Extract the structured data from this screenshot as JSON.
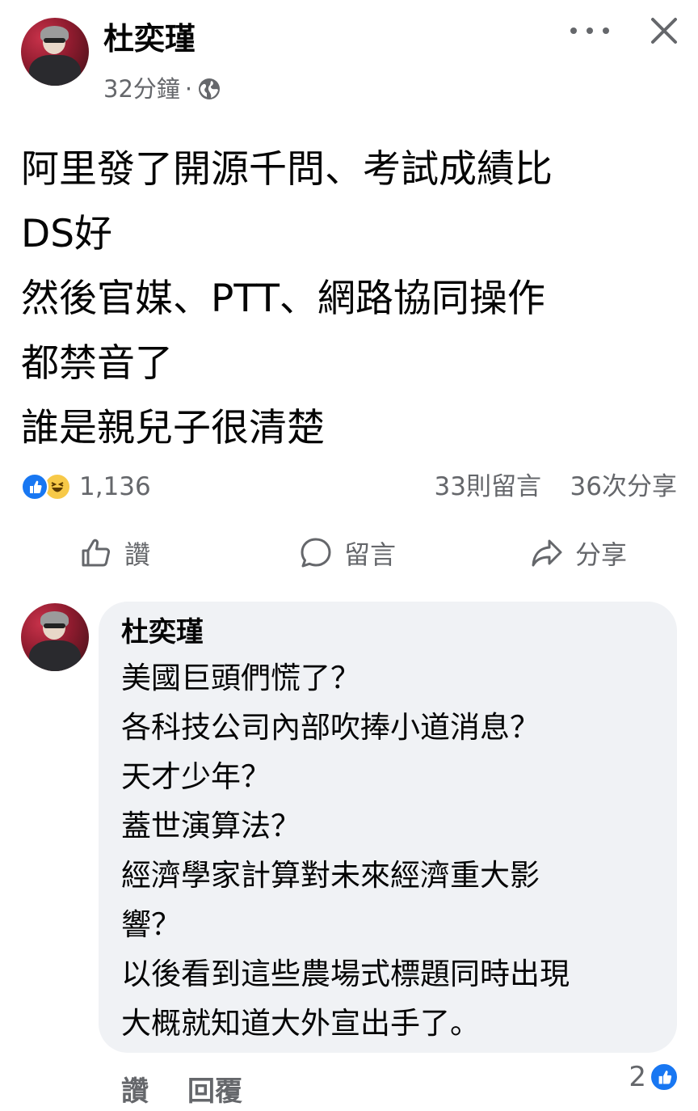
{
  "post": {
    "author": "杜奕瑾",
    "time": "32分鐘",
    "separator": "·",
    "privacy_icon": "globe-icon",
    "text_lines": [
      "阿里發了開源千問、考試成績比",
      "DS好",
      "然後官媒、PTT、網路協同操作",
      "都禁音了",
      "誰是親兒子很清楚"
    ],
    "reaction_icons": [
      "like-icon",
      "haha-icon"
    ],
    "reaction_count": "1,136",
    "comment_count": "33則留言",
    "share_count": "36次分享"
  },
  "actions": {
    "like": "讚",
    "comment": "留言",
    "share": "分享"
  },
  "comment": {
    "author": "杜奕瑾",
    "lines": [
      "美國巨頭們慌了？",
      "各科技公司內部吹捧小道消息？",
      "天才少年？",
      "蓋世演算法？",
      "經濟學家計算對未來經濟重大影",
      "響？",
      "以後看到這些農場式標題同時出現",
      "大概就知道大外宣出手了。"
    ],
    "like_label": "讚",
    "reply_label": "回覆",
    "reaction_count": "2"
  },
  "colors": {
    "accent": "#1877f2",
    "secondary_text": "#65676b",
    "bubble_bg": "#f0f2f5"
  }
}
